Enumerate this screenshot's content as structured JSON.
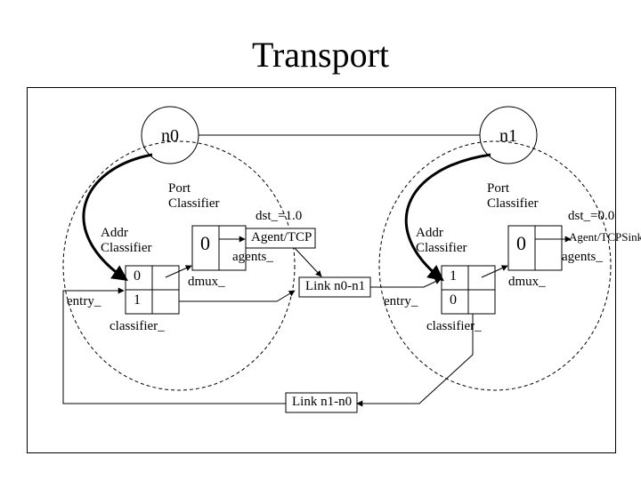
{
  "title": "Transport",
  "nodes": {
    "n0": "n0",
    "n1": "n1"
  },
  "left": {
    "port_classifier": "Port\nClassifier",
    "addr_classifier": "Addr\nClassifier",
    "dst": "dst_=1.0",
    "agent": "Agent/TCP",
    "agents": "agents_",
    "dmux": "dmux_",
    "entry": "entry_",
    "classifier": "classifier_",
    "slot0": "0",
    "slot1": "1",
    "port0": "0"
  },
  "right": {
    "port_classifier": "Port\nClassifier",
    "addr_classifier": "Addr\nClassifier",
    "dst": "dst_=0.0",
    "agent": "Agent/TCPSink",
    "agents": "agents_",
    "dmux": "dmux_",
    "entry": "entry_",
    "classifier": "classifier_",
    "slot0": "0",
    "slot1": "1",
    "port0": "0"
  },
  "links": {
    "l01": "Link n0-n1",
    "l10": "Link n1-n0"
  }
}
